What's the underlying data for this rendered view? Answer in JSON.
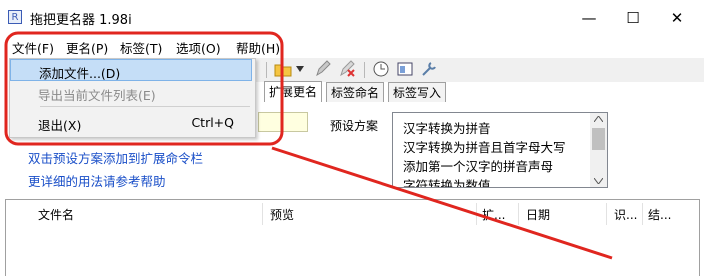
{
  "window": {
    "title": "拖把更名器 1.98i"
  },
  "window_controls": {
    "minimize": "—",
    "maximize": "☐",
    "close": "✕"
  },
  "menu": [
    {
      "label": "文件(F)"
    },
    {
      "label": "更名(P)"
    },
    {
      "label": "标签(T)"
    },
    {
      "label": "选项(O)"
    },
    {
      "label": "帮助(H)"
    }
  ],
  "file_menu": {
    "items": [
      {
        "label": "添加文件...(D)",
        "shortcut": "",
        "disabled": false,
        "highlighted": true
      },
      {
        "label": "导出当前文件列表(E)",
        "shortcut": "",
        "disabled": true
      },
      {
        "label": "退出(X)",
        "shortcut": "Ctrl+Q",
        "disabled": false
      }
    ]
  },
  "tabs": [
    {
      "label": "扩展更名",
      "active": true
    },
    {
      "label": "标签命名",
      "active": false
    },
    {
      "label": "标签写入",
      "active": false
    }
  ],
  "presets": {
    "label": "预设方案",
    "items": [
      "汉字转换为拼音",
      "汉字转换为拼音且首字母大写",
      "添加第一个汉字的拼音声母",
      "字符转换为数值"
    ]
  },
  "hints": {
    "line1": "双击预设方案添加到扩展命令栏",
    "line2": "更详细的用法请参考帮助"
  },
  "file_list": {
    "columns": [
      "文件名",
      "预览",
      "扩...",
      "日期",
      "识...",
      "结..."
    ]
  },
  "annotation_colors": {
    "highlight_red": "#e0261f"
  }
}
